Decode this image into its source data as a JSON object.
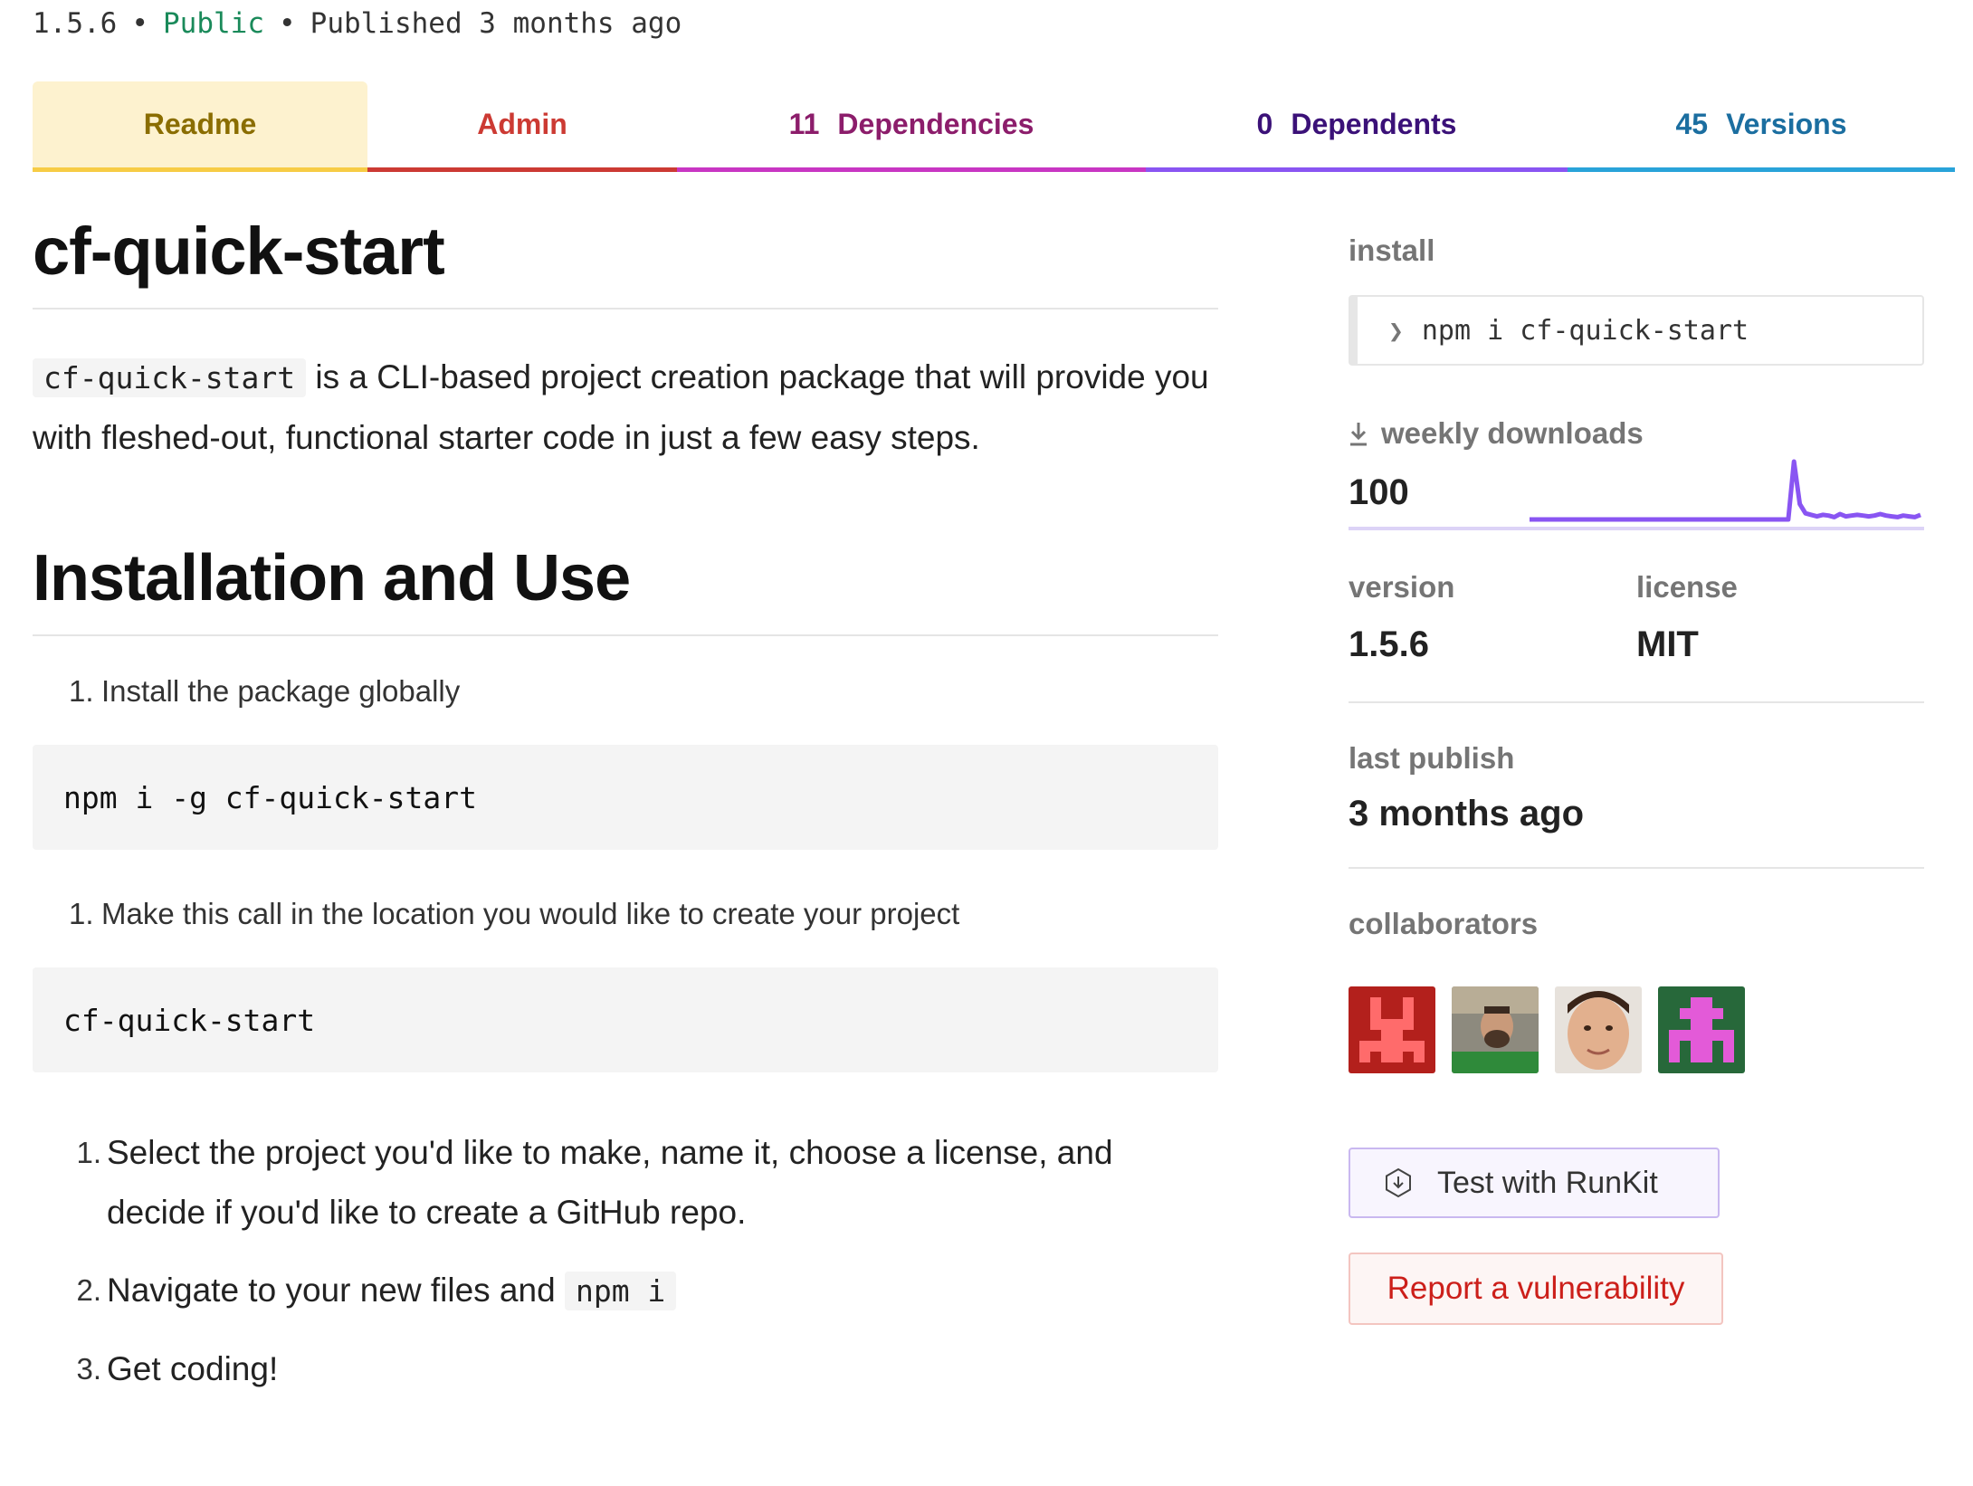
{
  "meta": {
    "version": "1.5.6",
    "visibility": "Public",
    "published": "Published 3 months ago",
    "separator": "•"
  },
  "tabs": [
    {
      "label": "Readme",
      "count": ""
    },
    {
      "label": "Admin",
      "count": ""
    },
    {
      "label": "Dependencies",
      "count": "11"
    },
    {
      "label": "Dependents",
      "count": "0"
    },
    {
      "label": "Versions",
      "count": "45"
    }
  ],
  "readme": {
    "title": "cf-quick-start",
    "intro_code": "cf-quick-start",
    "intro_text": " is a CLI-based project creation package that will provide you with fleshed-out, functional starter code in just a few easy steps.",
    "heading": "Installation and Use",
    "step1": {
      "num": "1.",
      "text": "Install the package globally"
    },
    "code1": "npm i -g cf-quick-start",
    "step2": {
      "num": "1.",
      "text": "Make this call in the location you would like to create your project"
    },
    "code2": "cf-quick-start",
    "list": [
      {
        "num": "1.",
        "text": "Select the project you'd like to make, name it, choose a license, and decide if you'd like to create a GitHub repo."
      },
      {
        "num": "2.",
        "text": "Navigate to your new files and ",
        "code": "npm i"
      },
      {
        "num": "3.",
        "text": "Get coding!"
      }
    ]
  },
  "sidebar": {
    "install_label": "install",
    "install_prompt": "❯",
    "install_command": "npm i cf-quick-start",
    "downloads_label": "weekly downloads",
    "downloads_value": "100",
    "version_label": "version",
    "version_value": "1.5.6",
    "license_label": "license",
    "license_value": "MIT",
    "last_publish_label": "last publish",
    "last_publish_value": "3 months ago",
    "collaborators_label": "collaborators",
    "runkit_label": "Test with RunKit",
    "vuln_label": "Report a vulnerability"
  },
  "colors": {
    "sparkline": "#8955f2",
    "public": "#1a8a5a",
    "vuln": "#cc1f1a"
  },
  "chart_data": {
    "type": "line",
    "series": [
      {
        "values": [
          1,
          1,
          1,
          1,
          1,
          1,
          1,
          1,
          1,
          1,
          1,
          1,
          1,
          1,
          1,
          1,
          1,
          1,
          1,
          1,
          1,
          1,
          1,
          1,
          1,
          1,
          1,
          1,
          1,
          1,
          1,
          1,
          1,
          1,
          1,
          1,
          1,
          1,
          1,
          1,
          1,
          1,
          1,
          1,
          1,
          1,
          8.5,
          3,
          1.8,
          1.6,
          1.4,
          1.6,
          1.5,
          1.3,
          1.7,
          1.4,
          1.5,
          1.6,
          1.5,
          1.4,
          1.5,
          1.7,
          1.5,
          1.4,
          1.3,
          1.5,
          1.4,
          1.3,
          1.6
        ]
      }
    ],
    "grid": false
  }
}
